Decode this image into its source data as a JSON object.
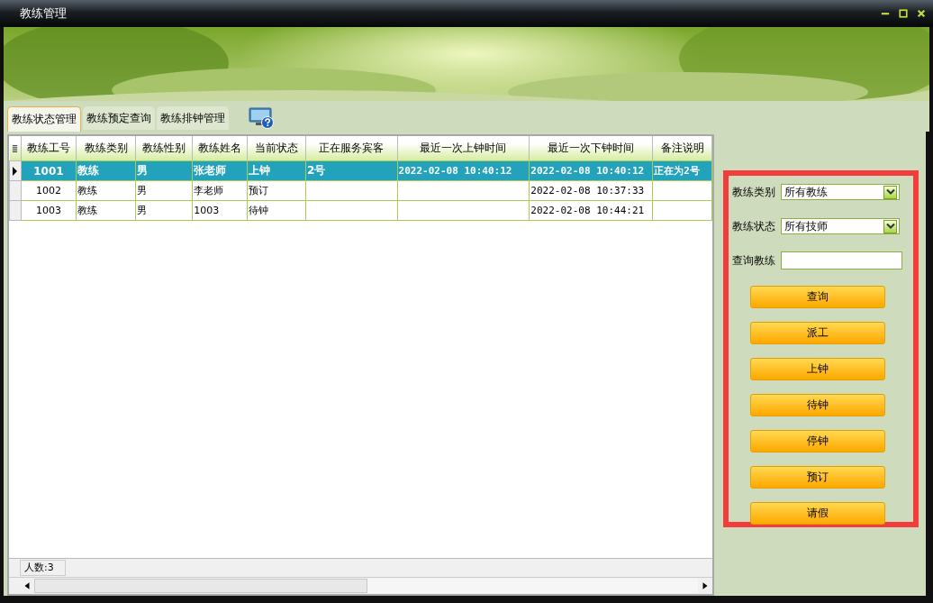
{
  "window": {
    "title": "教练管理"
  },
  "tabs": [
    {
      "label": "教练状态管理",
      "selected": true
    },
    {
      "label": "教练预定查询",
      "selected": false
    },
    {
      "label": "教练排钟管理",
      "selected": false
    }
  ],
  "table": {
    "columns": [
      "教练工号",
      "教练类别",
      "教练性别",
      "教练姓名",
      "当前状态",
      "正在服务宾客",
      "最近一次上钟时间",
      "最近一次下钟时间",
      "备注说明"
    ],
    "rows": [
      {
        "selected": true,
        "cells": [
          "1001",
          "教练",
          "男",
          "张老师",
          "上钟",
          "2号",
          "2022-02-08 10:40:12",
          "2022-02-08 10:40:12",
          "正在为2号"
        ]
      },
      {
        "selected": false,
        "cells": [
          "1002",
          "教练",
          "男",
          "李老师",
          "预订",
          "",
          "",
          "2022-02-08 10:37:33",
          ""
        ]
      },
      {
        "selected": false,
        "cells": [
          "1003",
          "教练",
          "男",
          "1003",
          "待钟",
          "",
          "",
          "2022-02-08 10:44:21",
          ""
        ]
      }
    ]
  },
  "status_bar": {
    "count": "人数:3"
  },
  "filter_panel": {
    "highlighted": true,
    "fields": [
      {
        "kind": "select",
        "label": "教练类别",
        "value": "所有教练"
      },
      {
        "kind": "select",
        "label": "教练状态",
        "value": "所有技师"
      },
      {
        "kind": "text",
        "label": "查询教练"
      }
    ],
    "buttons": [
      "查询",
      "派工",
      "上钟",
      "待钟",
      "停钟",
      "预订",
      "请假"
    ]
  }
}
